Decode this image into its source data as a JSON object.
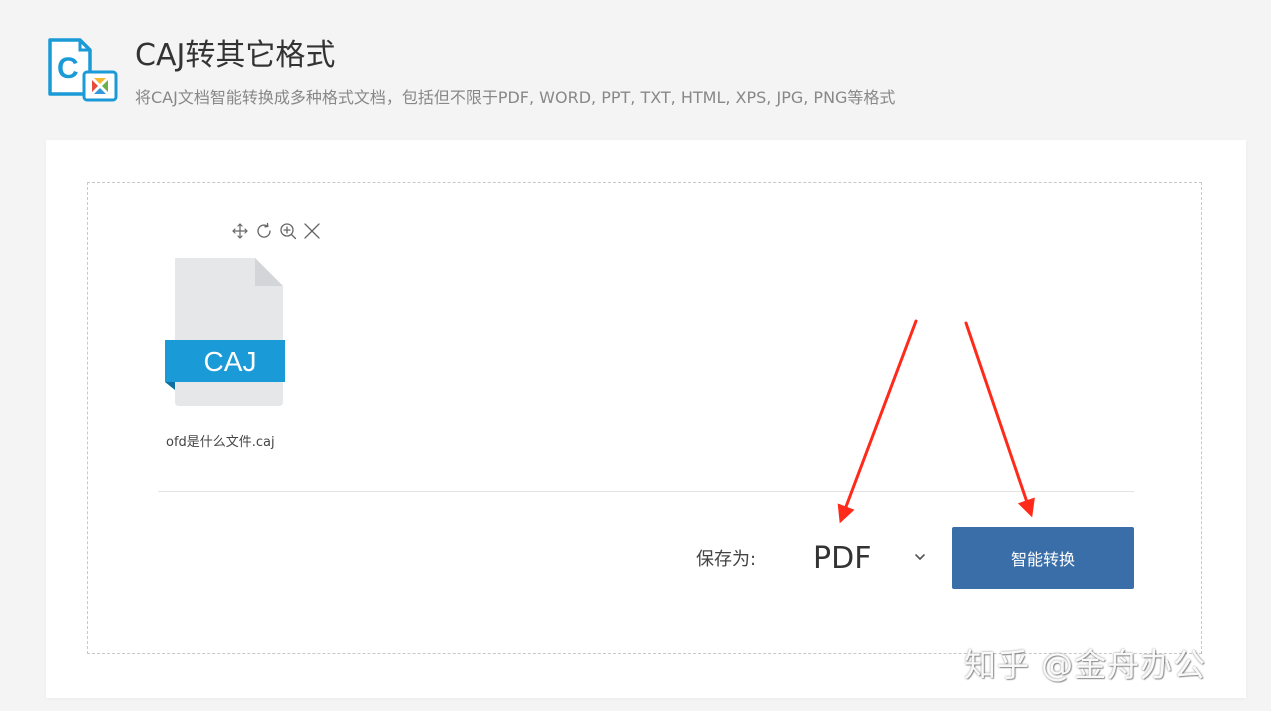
{
  "header": {
    "title": "CAJ转其它格式",
    "subtitle": "将CAJ文档智能转换成多种格式文档，包括但不限于PDF, WORD, PPT, TXT, HTML, XPS, JPG, PNG等格式",
    "logo_icon": "caj-convert-logo-icon",
    "logo_letter": "C"
  },
  "file": {
    "name": "ofd是什么文件.caj",
    "type_label": "CAJ",
    "toolbar": [
      {
        "icon": "move-icon",
        "action": "move"
      },
      {
        "icon": "rotate-icon",
        "action": "rotate"
      },
      {
        "icon": "zoom-in-icon",
        "action": "zoom"
      },
      {
        "icon": "close-icon",
        "action": "remove"
      }
    ]
  },
  "output": {
    "save_as_label": "保存为:",
    "selected_format": "PDF",
    "convert_label": "智能转换"
  },
  "watermark": "知乎 @金舟办公",
  "colors": {
    "accent": "#3a6ea8",
    "file_band": "#1a9ad6",
    "logo_blue": "#1a9ad6",
    "annotation": "#ff2a1a",
    "background": "#f4f4f4"
  }
}
